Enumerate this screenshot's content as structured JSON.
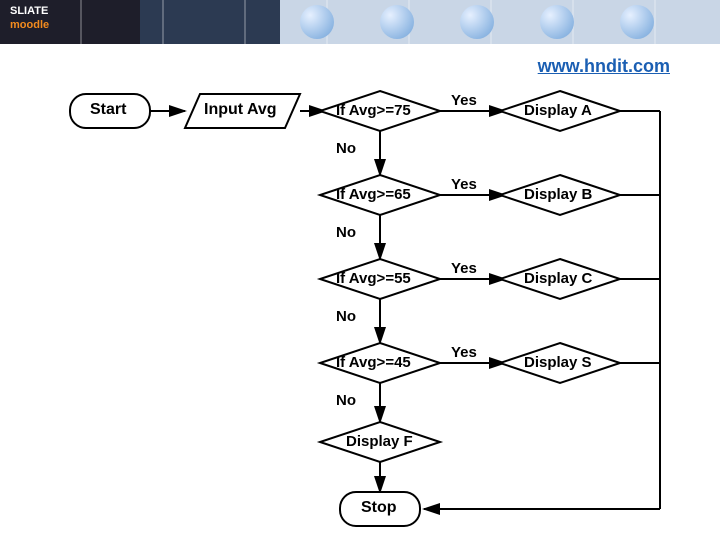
{
  "link": "www.hndit.com",
  "start": "Start",
  "stop": "Stop",
  "input": "Input Avg",
  "decisions": [
    {
      "cond": "If Avg>=75",
      "yes": "Yes",
      "no": "No",
      "out": "Display A"
    },
    {
      "cond": "If Avg>=65",
      "yes": "Yes",
      "no": "No",
      "out": "Display B"
    },
    {
      "cond": "If Avg>=55",
      "yes": "Yes",
      "no": "No",
      "out": "Display C"
    },
    {
      "cond": "If Avg>=45",
      "yes": "Yes",
      "no": "No",
      "out": "Display S"
    }
  ],
  "fail": "Display F",
  "logo_top": "SLIATE",
  "logo_bottom": "moodle"
}
